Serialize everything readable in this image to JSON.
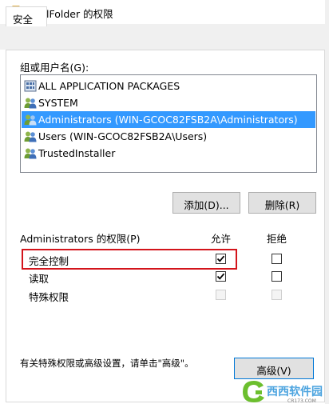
{
  "window": {
    "title": "ShellFolder 的权限",
    "folder_icon": "folder-icon"
  },
  "tabs": [
    {
      "label": "安全",
      "active": true
    }
  ],
  "groups": {
    "label": "组或用户名(G):",
    "items": [
      {
        "label": "ALL APPLICATION PACKAGES",
        "icon": "app-packages-icon",
        "selected": false
      },
      {
        "label": "SYSTEM",
        "icon": "users-icon",
        "selected": false
      },
      {
        "label": "Administrators (WIN-GCOC82FSB2A\\Administrators)",
        "icon": "users-icon",
        "selected": true
      },
      {
        "label": "Users (WIN-GCOC82FSB2A\\Users)",
        "icon": "users-icon",
        "selected": false
      },
      {
        "label": "TrustedInstaller",
        "icon": "users-icon",
        "selected": false
      }
    ]
  },
  "buttons": {
    "add": "添加(D)...",
    "remove": "删除(R)",
    "advanced": "高级(V)"
  },
  "permissions": {
    "label": "Administrators 的权限(P)",
    "allow_header": "允许",
    "deny_header": "拒绝",
    "rows": [
      {
        "label": "完全控制",
        "allow": true,
        "deny": false,
        "disabled": false
      },
      {
        "label": "读取",
        "allow": true,
        "deny": false,
        "disabled": false
      },
      {
        "label": "特殊权限",
        "allow": false,
        "deny": false,
        "disabled": true
      }
    ]
  },
  "advanced_hint": "有关特殊权限或高级设置，请单击\"高级\"。",
  "colors": {
    "selection": "#3399ff",
    "highlight_box": "#d3141b",
    "accent_border": "#0078d7"
  },
  "watermark": {
    "text": "西西软件园",
    "sub": "CR173.COM"
  }
}
